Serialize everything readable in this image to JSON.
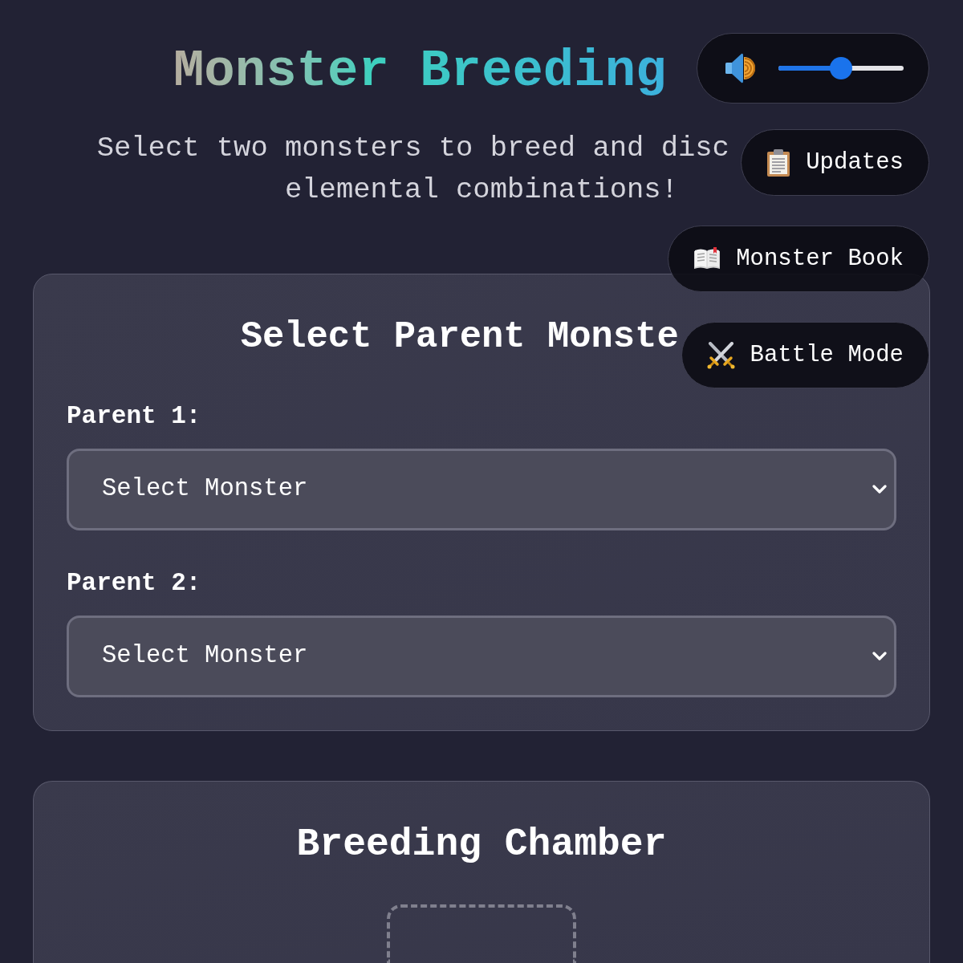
{
  "header": {
    "title": "Monster Breeding",
    "subtitle_lines": [
      "Select two monsters to breed and disc",
      "elemental combinations!"
    ]
  },
  "volume": {
    "level": 0.5
  },
  "nav_buttons": [
    {
      "kind": "updates",
      "label": "Updates"
    },
    {
      "kind": "book",
      "label": "Monster Book"
    },
    {
      "kind": "battle",
      "label": "Battle Mode"
    }
  ],
  "parent_panel": {
    "title": "Select Parent Monste",
    "fields": [
      {
        "label": "Parent 1:",
        "value": "Select Monster"
      },
      {
        "label": "Parent 2:",
        "value": "Select Monster"
      }
    ]
  },
  "breeding_chamber": {
    "title": "Breeding Chamber"
  }
}
